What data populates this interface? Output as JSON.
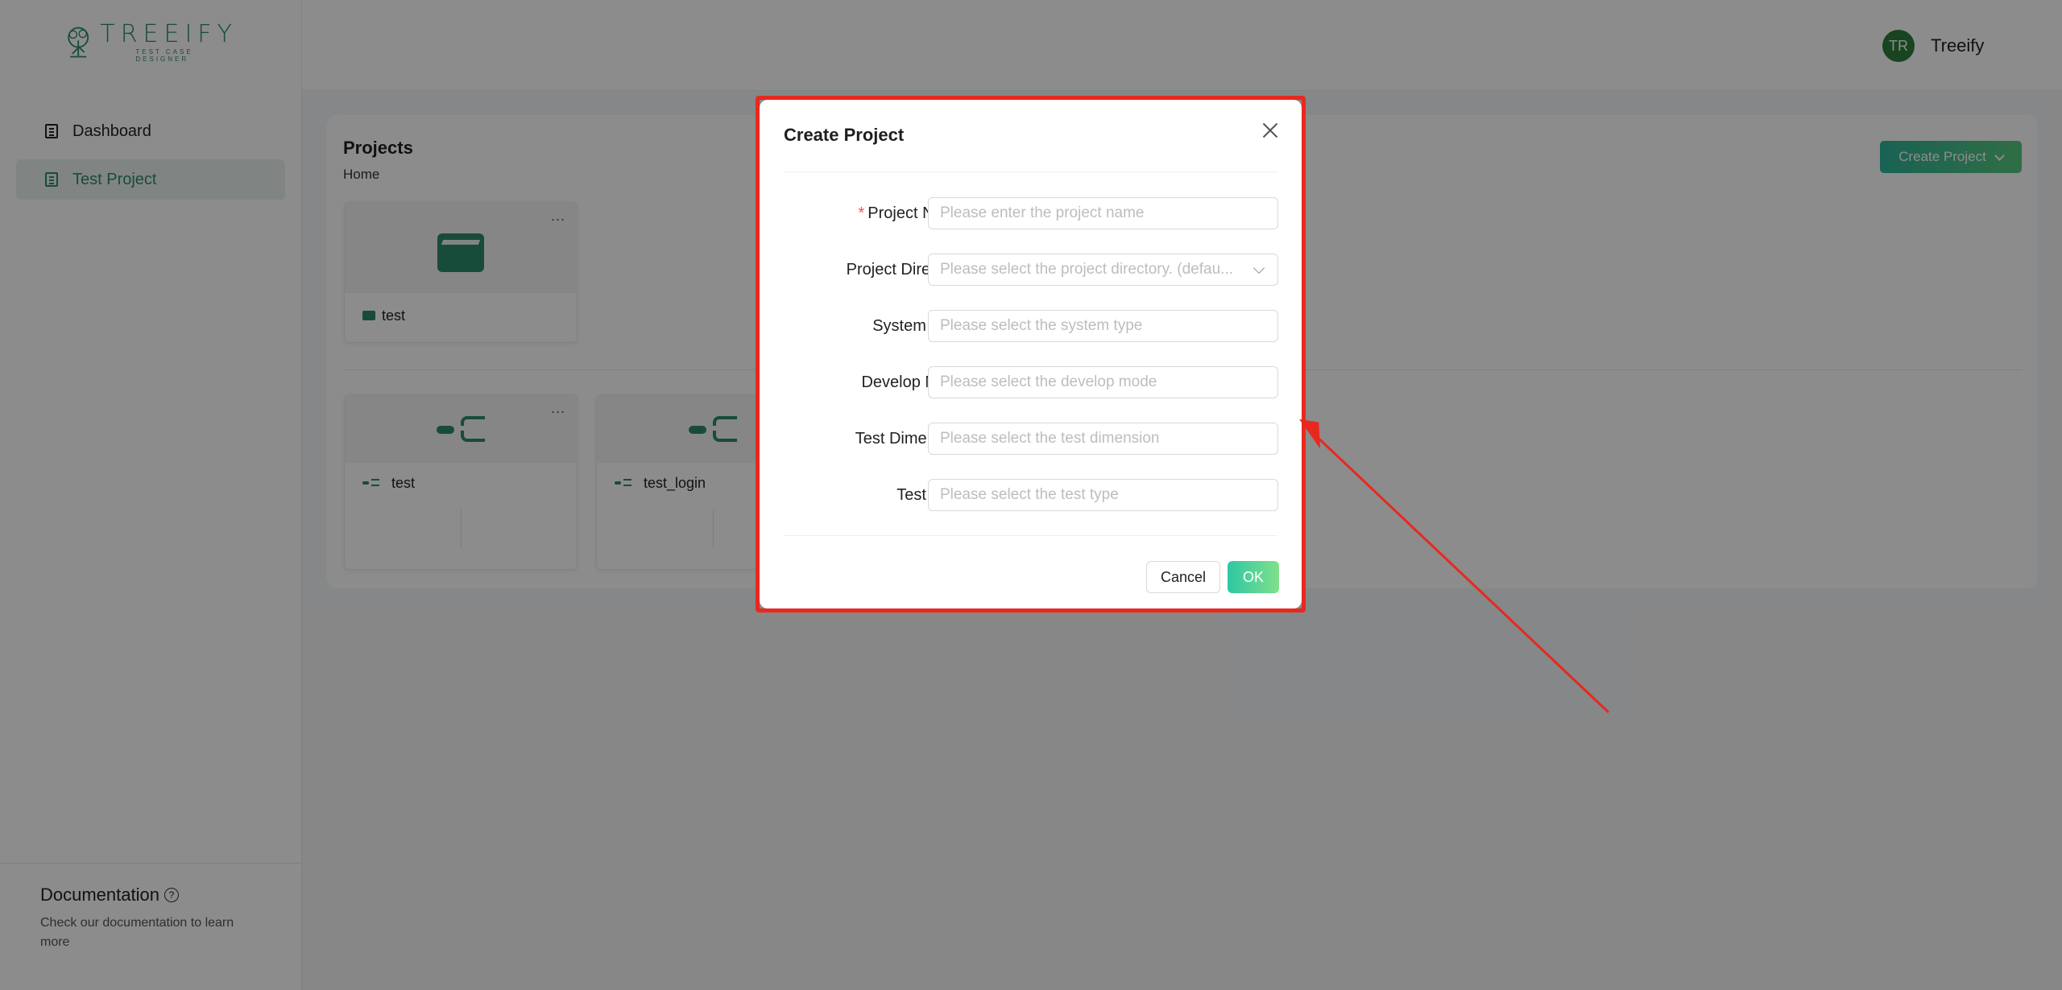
{
  "app": {
    "logo_word": "TREEIFY",
    "logo_sub": "TEST CASE DESIGNER"
  },
  "sidebar": {
    "items": [
      {
        "label": "Dashboard",
        "active": false
      },
      {
        "label": "Test Project",
        "active": true
      }
    ],
    "doc_title": "Documentation",
    "doc_help": "?",
    "doc_desc": "Check our documentation to learn more"
  },
  "header": {
    "avatar_initials": "TR",
    "username": "Treeify"
  },
  "main": {
    "title": "Projects",
    "breadcrumb": "Home",
    "create_button": "Create Project",
    "folders": [
      {
        "name": "test",
        "menu": "..."
      }
    ],
    "files": [
      {
        "name": "test",
        "menu": "..."
      },
      {
        "name": "test_login",
        "menu": "..."
      }
    ]
  },
  "modal": {
    "title": "Create Project",
    "fields": [
      {
        "label": "Project Name",
        "colon": ":",
        "required": true,
        "required_mark": "*",
        "placeholder": "Please enter the project name",
        "type": "input"
      },
      {
        "label": "Project Directory",
        "colon": ":",
        "required": false,
        "placeholder": "Please select the project directory. (defau...",
        "type": "select"
      },
      {
        "label": "System Type",
        "colon": ":",
        "required": false,
        "placeholder": "Please select the system type",
        "type": "input"
      },
      {
        "label": "Develop Mode",
        "colon": ":",
        "required": false,
        "placeholder": "Please select the develop mode",
        "type": "input"
      },
      {
        "label": "Test Dimension",
        "colon": ":",
        "required": false,
        "placeholder": "Please select the test dimension",
        "type": "input"
      },
      {
        "label": "Test Type",
        "colon": ":",
        "required": false,
        "placeholder": "Please select the test type",
        "type": "input"
      }
    ],
    "cancel_label": "Cancel",
    "ok_label": "OK"
  },
  "colors": {
    "brand": "#2c8a6a",
    "highlight_frame": "#e8281f",
    "annotation_arrow": "#e8281f"
  },
  "icons": [
    "tree-logo-icon",
    "dashboard-icon",
    "document-icon",
    "help-icon",
    "chevron-down-icon",
    "folder-icon",
    "mindmap-icon",
    "close-icon",
    "arrow-annotation"
  ]
}
